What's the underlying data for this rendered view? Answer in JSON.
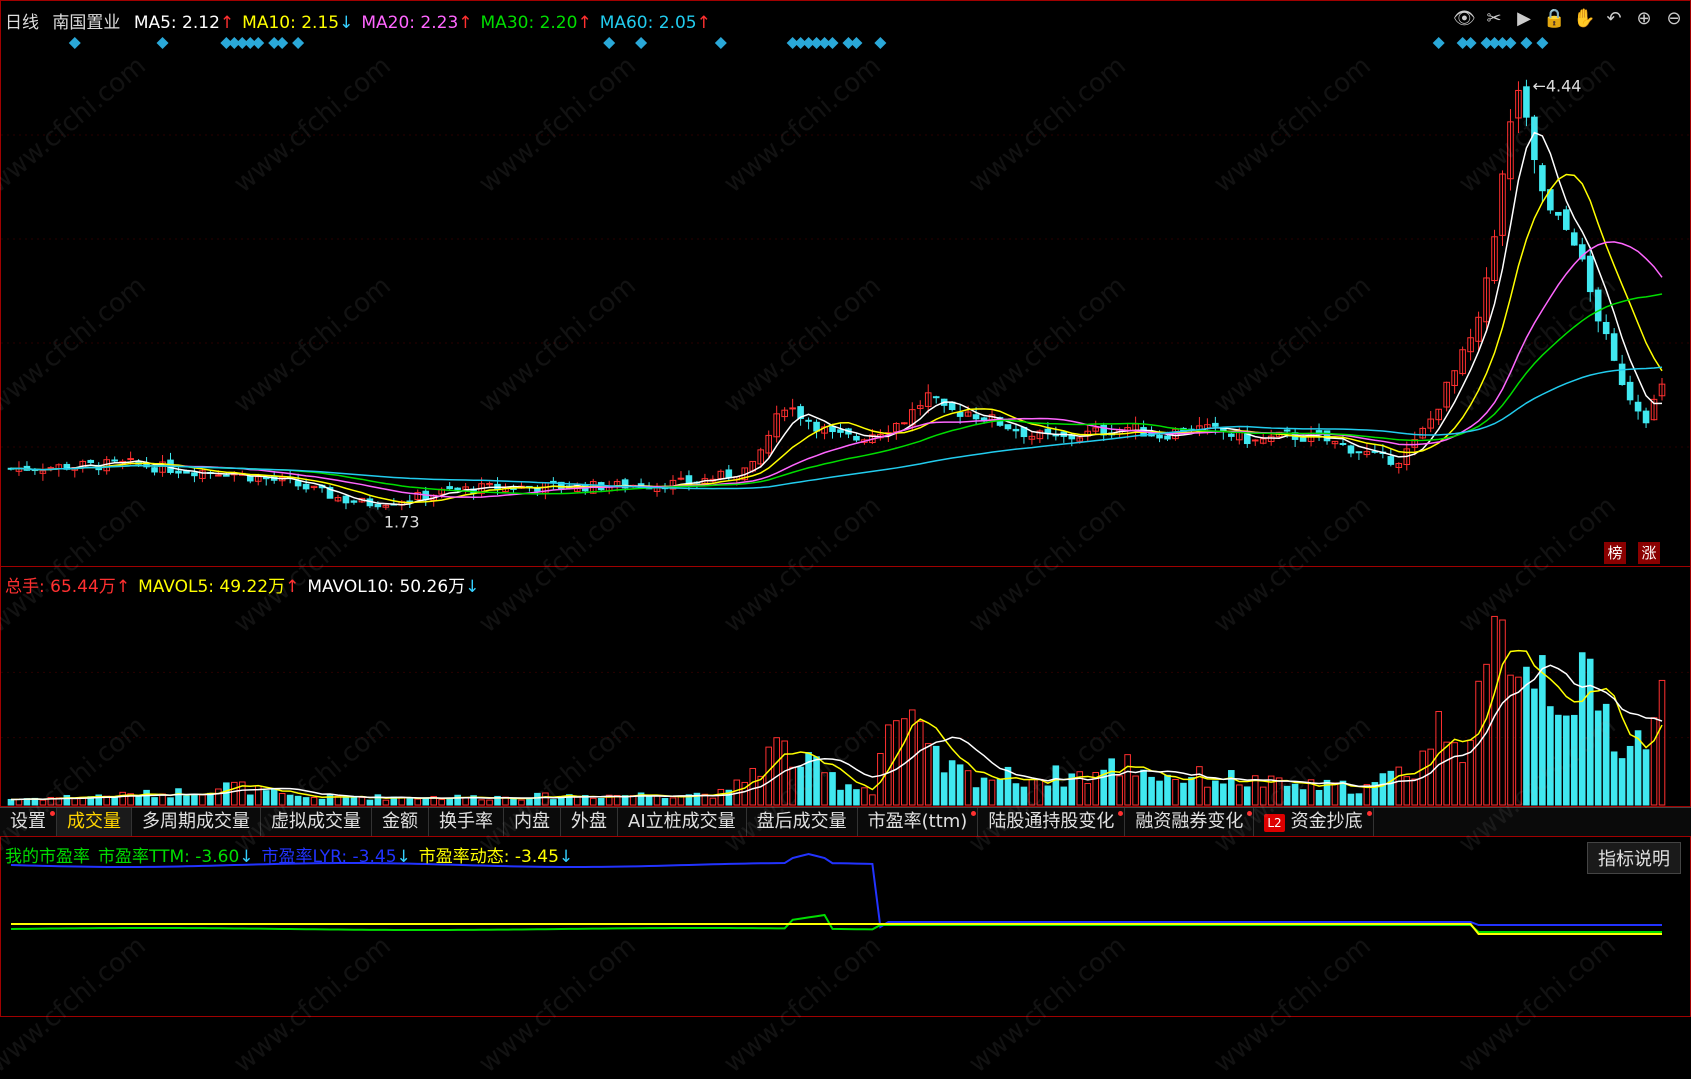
{
  "header": {
    "period": "日线",
    "stock_name": "南国置业",
    "ma_labels": [
      {
        "text": "MA5: 2.12",
        "arrow": "↑",
        "color": "#ffffff"
      },
      {
        "text": "MA10: 2.15",
        "arrow": "↓",
        "color": "#ffff00"
      },
      {
        "text": "MA20: 2.23",
        "arrow": "↑",
        "color": "#ff66ff"
      },
      {
        "text": "MA30: 2.20",
        "arrow": "↑",
        "color": "#00dd00"
      },
      {
        "text": "MA60: 2.05",
        "arrow": "↑",
        "color": "#22ccee"
      }
    ]
  },
  "toolbar_icons": [
    "eye-icon",
    "scissors-icon",
    "play-icon",
    "lock-icon",
    "hand-icon",
    "undo-icon",
    "zoom-in-icon",
    "zoom-out-icon"
  ],
  "badges": {
    "bang": "榜",
    "zhang": "涨"
  },
  "price_annotations": {
    "high": "4.44",
    "low": "1.73"
  },
  "volume_header": [
    {
      "text": "总手: 65.44万",
      "arrow": "↑",
      "color": "#ff3030"
    },
    {
      "text": "MAVOL5: 49.22万",
      "arrow": "↑",
      "color": "#ffff00"
    },
    {
      "text": "MAVOL10: 50.26万",
      "arrow": "↓",
      "color": "#ffffff"
    }
  ],
  "tabs": [
    {
      "label": "设置",
      "dot": true
    },
    {
      "label": "成交量",
      "dot": false,
      "active": true
    },
    {
      "label": "多周期成交量",
      "dot": false
    },
    {
      "label": "虚拟成交量",
      "dot": false
    },
    {
      "label": "金额",
      "dot": false
    },
    {
      "label": "换手率",
      "dot": false
    },
    {
      "label": "内盘",
      "dot": false
    },
    {
      "label": "外盘",
      "dot": false
    },
    {
      "label": "AI立桩成交量",
      "dot": false
    },
    {
      "label": "盘后成交量",
      "dot": false
    },
    {
      "label": "市盈率(ttm)",
      "dot": true
    },
    {
      "label": "陆股通持股变化",
      "dot": true
    },
    {
      "label": "融资融券变化",
      "dot": true
    },
    {
      "label": "资金抄底",
      "dot": true,
      "l2": "L2"
    }
  ],
  "pe_header": [
    {
      "text": "我的市盈率",
      "arrow": "",
      "color": "#00dd00"
    },
    {
      "text": "市盈率TTM: -3.60",
      "arrow": "↓",
      "color": "#00dd00"
    },
    {
      "text": "市盈率LYR: -3.45",
      "arrow": "↓",
      "color": "#2233ff"
    },
    {
      "text": "市盈率动态: -3.45",
      "arrow": "↓",
      "color": "#ffff00"
    }
  ],
  "explain_button": "指标说明",
  "watermark": "www.cfchi.com",
  "colors": {
    "up": "#ff3030",
    "down": "#40e8f0",
    "border": "#a00000",
    "signal": "#2aa8d8"
  },
  "chart_data": [
    {
      "type": "candlestick",
      "title": "南国置业 日线",
      "ylim": [
        1.5,
        4.6
      ],
      "high": 4.44,
      "low": 1.73,
      "anchors_close": [
        [
          0,
          1.99
        ],
        [
          15,
          2.02
        ],
        [
          22,
          1.98
        ],
        [
          27,
          1.97
        ],
        [
          30,
          1.94
        ],
        [
          35,
          1.9
        ],
        [
          42,
          1.79
        ],
        [
          45,
          1.77
        ],
        [
          50,
          1.8
        ],
        [
          55,
          1.85
        ],
        [
          60,
          1.87
        ],
        [
          75,
          1.88
        ],
        [
          85,
          1.9
        ],
        [
          90,
          1.95
        ],
        [
          93,
          2.0
        ],
        [
          95,
          2.2
        ],
        [
          97,
          2.4
        ],
        [
          100,
          2.3
        ],
        [
          103,
          2.2
        ],
        [
          106,
          2.18
        ],
        [
          110,
          2.25
        ],
        [
          112,
          2.3
        ],
        [
          115,
          2.45
        ],
        [
          117,
          2.35
        ],
        [
          120,
          2.35
        ],
        [
          124,
          2.28
        ],
        [
          128,
          2.2
        ],
        [
          132,
          2.18
        ],
        [
          136,
          2.22
        ],
        [
          140,
          2.25
        ],
        [
          144,
          2.2
        ],
        [
          148,
          2.25
        ],
        [
          152,
          2.22
        ],
        [
          156,
          2.16
        ],
        [
          160,
          2.2
        ],
        [
          164,
          2.18
        ],
        [
          168,
          2.12
        ],
        [
          172,
          2.05
        ],
        [
          174,
          2.05
        ],
        [
          176,
          2.15
        ],
        [
          178,
          2.3
        ],
        [
          180,
          2.5
        ],
        [
          182,
          2.7
        ],
        [
          184,
          2.9
        ],
        [
          186,
          3.5
        ],
        [
          188,
          4.15
        ],
        [
          189,
          4.4
        ],
        [
          191,
          3.9
        ],
        [
          193,
          3.6
        ],
        [
          196,
          3.45
        ],
        [
          198,
          3.1
        ],
        [
          201,
          2.65
        ],
        [
          203,
          2.45
        ],
        [
          205,
          2.32
        ],
        [
          207,
          2.5
        ]
      ],
      "volume_anchors": [
        [
          0,
          3
        ],
        [
          20,
          6
        ],
        [
          28,
          10
        ],
        [
          35,
          4
        ],
        [
          60,
          4
        ],
        [
          90,
          6
        ],
        [
          92,
          14
        ],
        [
          96,
          30
        ],
        [
          100,
          20
        ],
        [
          104,
          12
        ],
        [
          108,
          8
        ],
        [
          110,
          45
        ],
        [
          113,
          38
        ],
        [
          116,
          22
        ],
        [
          120,
          15
        ],
        [
          128,
          14
        ],
        [
          136,
          16
        ],
        [
          140,
          22
        ],
        [
          144,
          15
        ],
        [
          152,
          14
        ],
        [
          160,
          10
        ],
        [
          170,
          9
        ],
        [
          176,
          20
        ],
        [
          180,
          45
        ],
        [
          183,
          32
        ],
        [
          186,
          75
        ],
        [
          188,
          95
        ],
        [
          190,
          80
        ],
        [
          192,
          72
        ],
        [
          194,
          65
        ],
        [
          196,
          62
        ],
        [
          198,
          55
        ],
        [
          201,
          40
        ],
        [
          203,
          30
        ],
        [
          205,
          38
        ],
        [
          207,
          55
        ]
      ]
    },
    {
      "type": "line",
      "title": "市盈率",
      "series": [
        {
          "name": "市盈率TTM",
          "color": "#00dd00"
        },
        {
          "name": "市盈率LYR",
          "color": "#2233ff"
        },
        {
          "name": "市盈率动态",
          "color": "#ffff00"
        }
      ]
    }
  ]
}
